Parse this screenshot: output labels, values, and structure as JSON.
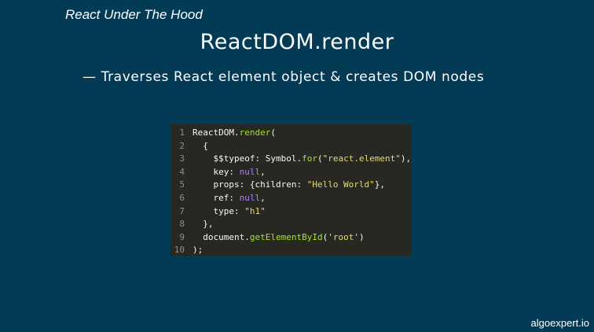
{
  "slide": {
    "title": "React Under The Hood",
    "heading": "ReactDOM.render",
    "bullet": "— Traverses React element object & creates DOM nodes",
    "brand": "algoexpert.io"
  },
  "code": {
    "lines": [
      {
        "num": "1",
        "tokens": [
          {
            "t": "ReactDOM.",
            "c": "plain"
          },
          {
            "t": "render",
            "c": "fn"
          },
          {
            "t": "(",
            "c": "plain"
          }
        ]
      },
      {
        "num": "2",
        "tokens": [
          {
            "t": "  {",
            "c": "plain"
          }
        ]
      },
      {
        "num": "3",
        "tokens": [
          {
            "t": "    $$typeof: Symbol.",
            "c": "plain"
          },
          {
            "t": "for",
            "c": "fn"
          },
          {
            "t": "(",
            "c": "plain"
          },
          {
            "t": "\"react.element\"",
            "c": "str"
          },
          {
            "t": "),",
            "c": "plain"
          }
        ]
      },
      {
        "num": "4",
        "tokens": [
          {
            "t": "    key: ",
            "c": "plain"
          },
          {
            "t": "null",
            "c": "kw"
          },
          {
            "t": ",",
            "c": "plain"
          }
        ]
      },
      {
        "num": "5",
        "tokens": [
          {
            "t": "    props: {children: ",
            "c": "plain"
          },
          {
            "t": "\"Hello World\"",
            "c": "str"
          },
          {
            "t": "},",
            "c": "plain"
          }
        ]
      },
      {
        "num": "6",
        "tokens": [
          {
            "t": "    ref: ",
            "c": "plain"
          },
          {
            "t": "null",
            "c": "kw"
          },
          {
            "t": ",",
            "c": "plain"
          }
        ]
      },
      {
        "num": "7",
        "tokens": [
          {
            "t": "    type: ",
            "c": "plain"
          },
          {
            "t": "\"h1\"",
            "c": "str"
          }
        ]
      },
      {
        "num": "8",
        "tokens": [
          {
            "t": "  },",
            "c": "plain"
          }
        ]
      },
      {
        "num": "9",
        "tokens": [
          {
            "t": "  document.",
            "c": "plain"
          },
          {
            "t": "getElementById",
            "c": "fn"
          },
          {
            "t": "(",
            "c": "plain"
          },
          {
            "t": "'root'",
            "c": "str"
          },
          {
            "t": ")",
            "c": "plain"
          }
        ]
      },
      {
        "num": "10",
        "tokens": [
          {
            "t": ");",
            "c": "plain"
          }
        ]
      }
    ]
  },
  "colors": {
    "background": "#033a56",
    "code_background": "#272822",
    "function": "#a6e22e",
    "string": "#e6db74",
    "keyword": "#ae81ff",
    "text": "#f8f8f2",
    "line_number": "#8f908a"
  }
}
